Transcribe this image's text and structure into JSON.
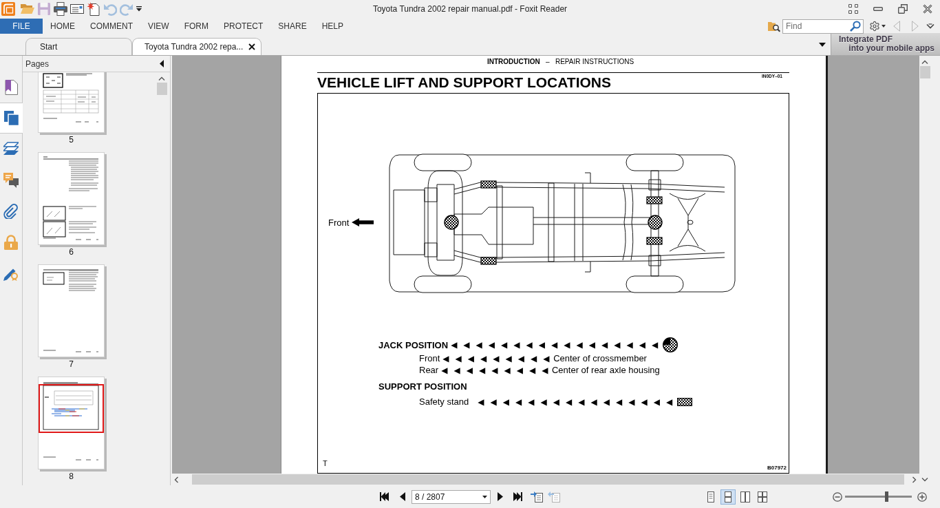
{
  "title_bar": {
    "quick_access": [
      {
        "kind": "app-logo",
        "disabled": false
      },
      {
        "kind": "open",
        "disabled": false
      },
      {
        "kind": "save",
        "disabled": true
      },
      {
        "kind": "print",
        "disabled": false
      },
      {
        "kind": "envelope",
        "disabled": false
      },
      {
        "kind": "new",
        "disabled": false
      },
      {
        "kind": "undo",
        "disabled": true
      },
      {
        "kind": "redo",
        "disabled": true
      },
      {
        "kind": "customize",
        "disabled": false
      }
    ],
    "title": "Toyota Tundra 2002 repair manual.pdf - Foxit Reader"
  },
  "ribbon_tabs": [
    {
      "label": "FILE",
      "selected": true
    },
    {
      "label": "HOME",
      "selected": false
    },
    {
      "label": "COMMENT",
      "selected": false
    },
    {
      "label": "VIEW",
      "selected": false
    },
    {
      "label": "FORM",
      "selected": false
    },
    {
      "label": "PROTECT",
      "selected": false
    },
    {
      "label": "SHARE",
      "selected": false
    },
    {
      "label": "HELP",
      "selected": false
    }
  ],
  "find": {
    "placeholder": "Find"
  },
  "document_tabs": [
    {
      "label": "Start",
      "selected": false
    },
    {
      "label": "Toyota Tundra 2002 repa...",
      "selected": true
    }
  ],
  "ad_banner": {
    "line_1": "Integrate PDF",
    "line_2": "into your mobile apps"
  },
  "side_panel_tabs": [
    {
      "kind": "bookmarks",
      "selected": false
    },
    {
      "kind": "pages",
      "selected": true
    },
    {
      "kind": "layers",
      "selected": false
    },
    {
      "kind": "comments",
      "selected": false
    },
    {
      "kind": "attachments",
      "selected": false
    },
    {
      "kind": "security",
      "selected": false
    },
    {
      "kind": "signatures",
      "selected": false
    }
  ],
  "pages_panel": {
    "title": "Pages",
    "thumbnails": [
      {
        "label": "5",
        "kind": "table",
        "selected": false
      },
      {
        "label": "6",
        "kind": "text-figures",
        "selected": false
      },
      {
        "label": "7",
        "kind": "text",
        "selected": false
      },
      {
        "label": "8",
        "kind": "diagram",
        "selected": true
      }
    ]
  },
  "document": {
    "running_header": "**INTRODUCTION**   –   REPAIR INSTRUCTIONS",
    "section_code": "IN0DY–01",
    "title": "VEHICLE LIFT AND SUPPORT LOCATIONS",
    "figure": {
      "direction_label": "Front",
      "legend": [
        {
          "kind": "heading",
          "label": "JACK POSITION",
          "leader": "◀ ◀ ◀ ◀ ◀ ◀ ◀ ◀ ◀ ◀ ◀ ◀ ◀ ◀ ◀ ◀ ◀",
          "symbol": {
            "kind": "jack-point"
          }
        },
        {
          "kind": "item",
          "label": "Front",
          "leader": "◀ ◀ ◀ ◀ ◀ ◀ ◀ ◀ ◀",
          "description": "Center of crossmember"
        },
        {
          "kind": "item",
          "label": "Rear",
          "leader": "◀ ◀ ◀ ◀ ◀ ◀ ◀ ◀ ◀",
          "description": "Center of rear axle housing"
        },
        {
          "kind": "heading",
          "label": "SUPPORT POSITION"
        },
        {
          "kind": "item",
          "label": "Safety stand",
          "leader": "◀ ◀ ◀ ◀ ◀ ◀ ◀ ◀ ◀ ◀ ◀ ◀ ◀ ◀ ◀ ◀",
          "symbol": {
            "kind": "support-point"
          }
        }
      ],
      "corner_mark": "T",
      "figure_code": "B07972"
    }
  },
  "status_bar": {
    "page_field": "8 / 2807",
    "view_modes": [
      {
        "kind": "single",
        "selected": false
      },
      {
        "kind": "continuous",
        "selected": true
      },
      {
        "kind": "facing",
        "selected": false
      },
      {
        "kind": "continuous-facing",
        "selected": false
      }
    ],
    "zoom": {
      "level": 0.62
    }
  }
}
